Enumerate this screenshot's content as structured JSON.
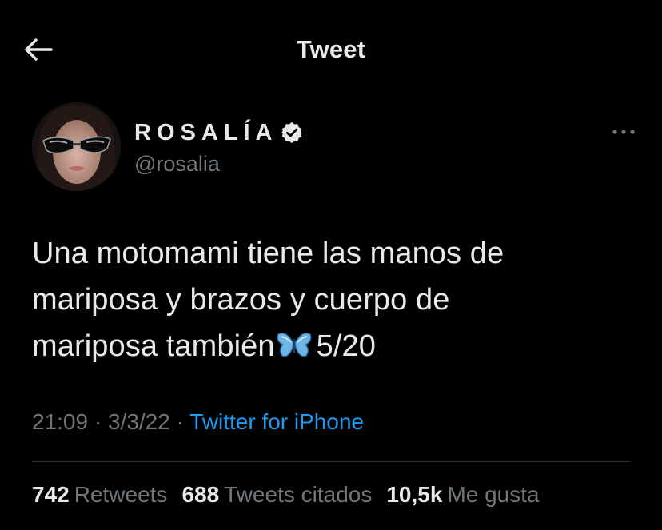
{
  "header": {
    "title": "Tweet",
    "back_icon": "arrow-left-icon"
  },
  "author": {
    "display_name": "ROSALÍA",
    "handle": "@rosalia",
    "verified": true,
    "verified_icon": "verified-badge-icon",
    "more_icon": "more-horizontal-icon"
  },
  "tweet": {
    "lines": [
      "Una motomami tiene las manos de",
      "mariposa y brazos y cuerpo de",
      "mariposa también"
    ],
    "emoji_icon": "butterfly-icon",
    "counter": "5/20"
  },
  "meta": {
    "time": "21:09",
    "separator": "·",
    "date": "3/3/22",
    "source": "Twitter for iPhone"
  },
  "stats": {
    "retweets_count": "742",
    "retweets_label": "Retweets",
    "quotes_count": "688",
    "quotes_label": "Tweets citados",
    "likes_count": "10,5k",
    "likes_label": "Me gusta"
  },
  "colors": {
    "background": "#000000",
    "text_primary": "#e7e9ea",
    "text_secondary": "#71767b",
    "link": "#1d9bf0",
    "divider": "#2f3336",
    "butterfly": "#6fb6e8"
  }
}
